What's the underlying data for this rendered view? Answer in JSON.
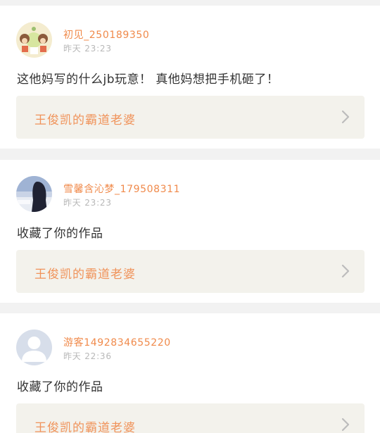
{
  "comments": [
    {
      "username": "初见_250189350",
      "time": "昨天 23:23",
      "text": "这他妈写的什么jb玩意！ 真他妈想把手机砸了！",
      "work_title": "王俊凯的霸道老婆",
      "avatar_icon": "cartoon-avatar"
    },
    {
      "username": "雪馨含沁梦_179508311",
      "time": "昨天 23:23",
      "text": "收藏了你的作品",
      "work_title": "王俊凯的霸道老婆",
      "avatar_icon": "photo-avatar"
    },
    {
      "username": "游客1492834655220",
      "time": "昨天 22:36",
      "text": "收藏了你的作品",
      "work_title": "王俊凯的霸道老婆",
      "avatar_icon": "default-user-avatar"
    }
  ],
  "colors": {
    "username": "#f08a4b",
    "work_title": "#f0935a",
    "work_bg": "#f3f2ec",
    "page_bg": "#f2f2f2"
  }
}
